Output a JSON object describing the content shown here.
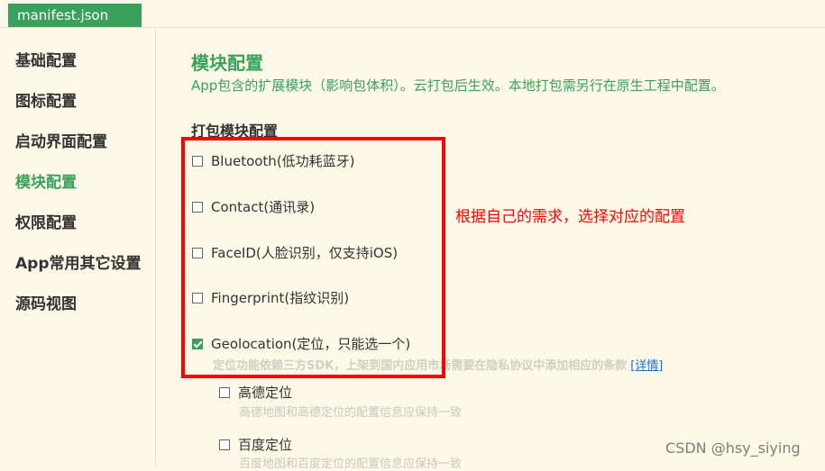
{
  "tab": {
    "label": "manifest.json"
  },
  "sidebar": {
    "items": [
      {
        "label": "基础配置"
      },
      {
        "label": "图标配置"
      },
      {
        "label": "启动界面配置"
      },
      {
        "label": "模块配置"
      },
      {
        "label": "权限配置"
      },
      {
        "label": "App常用其它设置"
      },
      {
        "label": "源码视图"
      }
    ],
    "active_index": 3
  },
  "main": {
    "title": "模块配置",
    "description": "App包含的扩展模块（影响包体积）。云打包后生效。本地打包需另行在原生工程中配置。",
    "section_title": "打包模块配置",
    "modules": [
      {
        "label": "Bluetooth(低功耗蓝牙)",
        "checked": false
      },
      {
        "label": "Contact(通讯录)",
        "checked": false
      },
      {
        "label": "FaceID(人脸识别，仅支持iOS)",
        "checked": false
      },
      {
        "label": "Fingerprint(指纹识别)",
        "checked": false
      },
      {
        "label": "Geolocation(定位，只能选一个)",
        "checked": true
      }
    ],
    "geolocation_note": "定位功能依赖三方SDK，上架到国内应用市场需要在隐私协议中添加相应的条款",
    "details_link": "[详情]",
    "geolocation_options": [
      {
        "label": "高德定位",
        "note": "高德地图和高德定位的配置信息应保持一致",
        "checked": false
      },
      {
        "label": "百度定位",
        "note": "百度地图和百度定位的配置信息应保持一致",
        "checked": false
      }
    ]
  },
  "annotation": {
    "text": "根据自己的需求，选择对应的配置"
  },
  "watermark": {
    "text": "CSDN @hsy_siying"
  },
  "colors": {
    "accent": "#3aa15c",
    "background": "#fdf9e8",
    "annotation": "#ff0000",
    "link": "#1a6fd6"
  }
}
